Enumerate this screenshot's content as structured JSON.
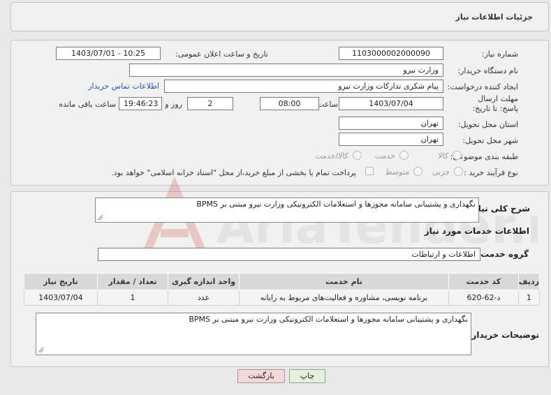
{
  "header": {
    "title": "جزئیات اطلاعات نیاز"
  },
  "form": {
    "need_number_label": "شماره نیاز:",
    "need_number": "1103000002000090",
    "announce_label": "تاریخ و ساعت اعلان عمومی:",
    "announce_value": "1403/07/01 - 10:25",
    "buyer_org_label": "نام دستگاه خریدار:",
    "buyer_org": "وزارت نیرو",
    "creator_label": "ایجاد کننده درخواست:",
    "creator": "پیام شکری تدارکات وزارت نیرو",
    "contact_link": "اطلاعات تماس خریدار",
    "deadline_label": "مهلت ارسال پاسخ: تا تاریخ:",
    "deadline_date": "1403/07/04",
    "time_label": "ساعت",
    "deadline_time": "08:00",
    "days_value": "2",
    "days_label": "روز و",
    "remaining_time": "19:46:23",
    "remaining_label": "ساعت باقی مانده",
    "province_label": "استان محل تحویل:",
    "province": "تهران",
    "city_label": "شهر محل تحویل:",
    "city": "تهران",
    "category_label": "طبقه بندی موضوعی:",
    "category_options": [
      "کالا",
      "خدمت",
      "کالا/خدمت"
    ],
    "process_label": "نوع فرآیند خرید :",
    "process_options": [
      "جزیی",
      "متوسط"
    ],
    "payment_note": "پرداخت تمام یا بخشی از مبلغ خرید،از محل \"اسناد خزانه اسلامی\" خواهد بود."
  },
  "summary": {
    "label": "شرح کلی نیاز:",
    "text": "نگهداری و پشتیبانی سامانه مجوزها و استعلامات الکترونیکی وزارت نیرو مبتنی بر BPMS"
  },
  "services": {
    "section_title": "اطلاعات خدمات مورد نیاز",
    "group_label": "گروه خدمت:",
    "group_value": "اطلاعات و ارتباطات",
    "columns": [
      "ردیف",
      "کد خدمت",
      "نام خدمت",
      "واحد اندازه گیری",
      "تعداد / مقدار",
      "تاریخ نیاز"
    ],
    "rows": [
      [
        "1",
        "د-62-620",
        "برنامه نویسی، مشاوره و فعالیت‌های مربوط به رایانه",
        "عدد",
        "1",
        "1403/07/04"
      ]
    ]
  },
  "buyer_notes": {
    "label": "توضیحات خریدار:",
    "text": "نگهداری و پشتیبانی سامانه مجوزها و استعلامات الکترونیکی وزارت نیرو مبتنی بر BPMS"
  },
  "buttons": {
    "print": "چاپ",
    "back": "بازگشت"
  },
  "watermark": {
    "text": "AriaTender.net"
  },
  "colors": {
    "link": "#2a55b0",
    "watermark": "#c0392b",
    "back_button": "#f7d7d7",
    "print_button": "#e2f2dc"
  }
}
